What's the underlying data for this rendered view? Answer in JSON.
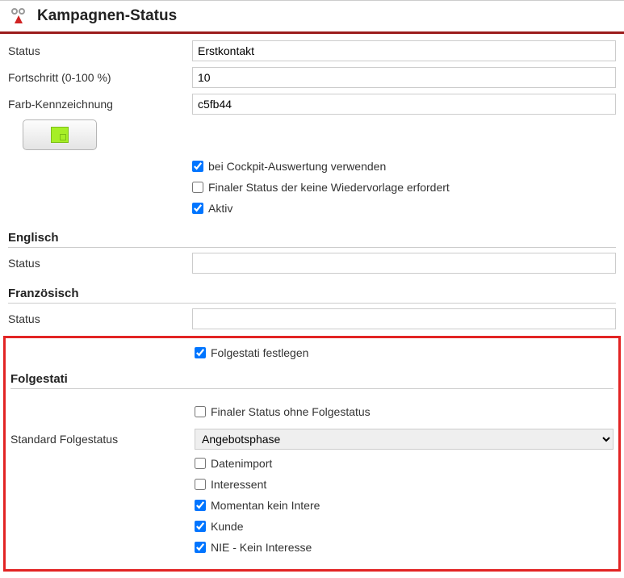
{
  "header": {
    "title": "Kampagnen-Status"
  },
  "fields": {
    "status_label": "Status",
    "status_value": "Erstkontakt",
    "progress_label": "Fortschritt (0-100 %)",
    "progress_value": "10",
    "color_label": "Farb-Kennzeichnung",
    "color_value": "c5fb44"
  },
  "flags": {
    "cockpit_label": "bei Cockpit-Auswertung verwenden",
    "final_no_resubmit_label": "Finaler Status der keine Wiedervorlage erfordert",
    "active_label": "Aktiv"
  },
  "english": {
    "heading": "Englisch",
    "status_label": "Status",
    "status_value": ""
  },
  "french": {
    "heading": "Französisch",
    "status_label": "Status",
    "status_value": ""
  },
  "folgestati": {
    "define_label": "Folgestati festlegen",
    "heading": "Folgestati",
    "final_no_follow_label": "Finaler Status ohne Folgestatus",
    "standard_label": "Standard Folgestatus",
    "standard_selected": "Angebotsphase",
    "options": {
      "datenimport": "Datenimport",
      "interessent": "Interessent",
      "momentan": "Momentan kein Intere",
      "kunde": "Kunde",
      "nie": "NIE - Kein Interesse"
    }
  }
}
